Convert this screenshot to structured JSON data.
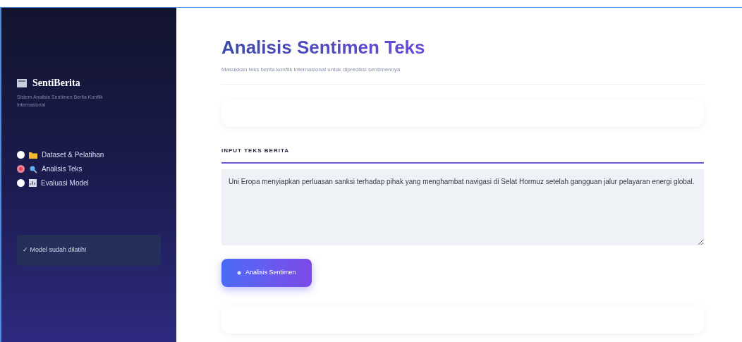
{
  "sidebar": {
    "brand": "SentiBerita",
    "subtitle": "Sistem Analisis Sentimen Berita Konflik Internasional",
    "nav": [
      {
        "label": "Dataset & Pelatihan",
        "selected": false
      },
      {
        "label": "Analisis Teks",
        "selected": true
      },
      {
        "label": "Evaluasi Model",
        "selected": false
      }
    ],
    "status": "✓ Model sudah dilatih!"
  },
  "main": {
    "title": "Analisis Sentimen Teks",
    "subtitle": "Masukkan teks berita konflik internasional untuk diprediksi sentimennya",
    "section_title": "INPUT TEKS BERITA",
    "input_value": "Uni Eropa menyiapkan perluasan sanksi terhadap pihak yang menghambat navigasi di Selat Hormuz setelah gangguan jalur pelayaran energi global.",
    "button": "Analisis Sentimen"
  }
}
